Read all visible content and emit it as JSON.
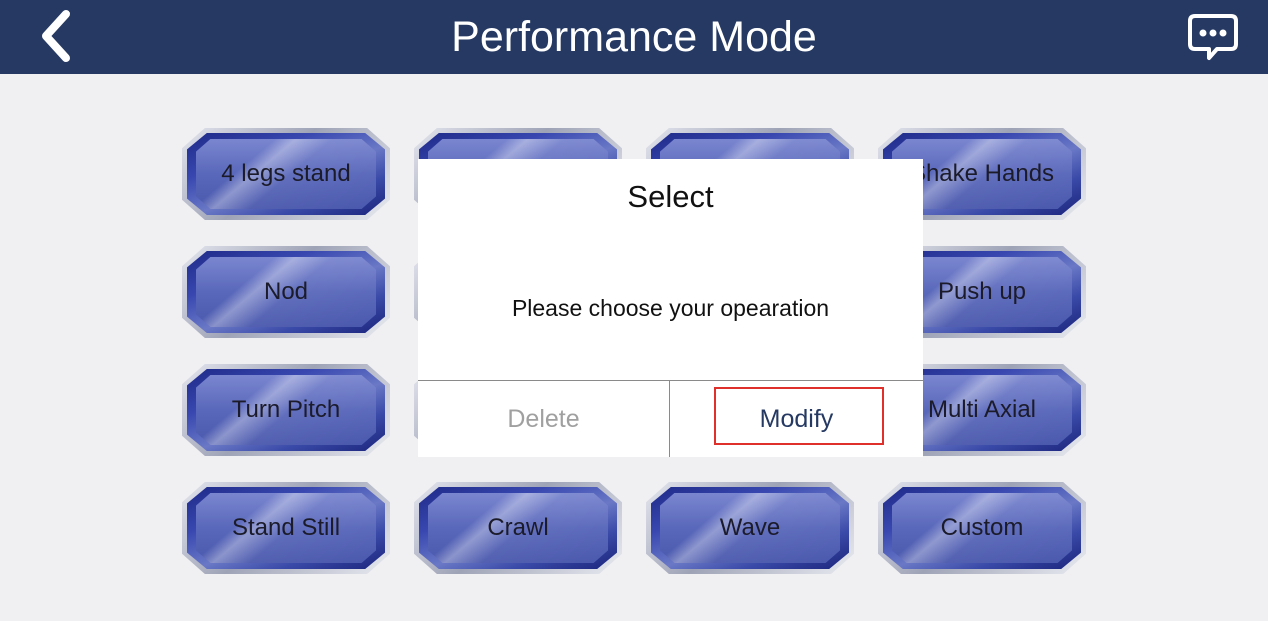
{
  "header": {
    "title": "Performance Mode",
    "back_icon": "chevron-left-icon",
    "chat_icon": "chat-bubble-icon",
    "background_color": "#253963"
  },
  "actions": [
    "4 legs stand",
    "",
    "",
    "Shake Hands",
    "Nod",
    "",
    "",
    "Push up",
    "Turn Pitch",
    "",
    "",
    "Multi Axial",
    "Stand Still",
    "Crawl",
    "Wave",
    "Custom"
  ],
  "dialog": {
    "title": "Select",
    "message": "Please choose your opearation",
    "delete_label": "Delete",
    "modify_label": "Modify",
    "highlight_color": "#e0302c"
  }
}
